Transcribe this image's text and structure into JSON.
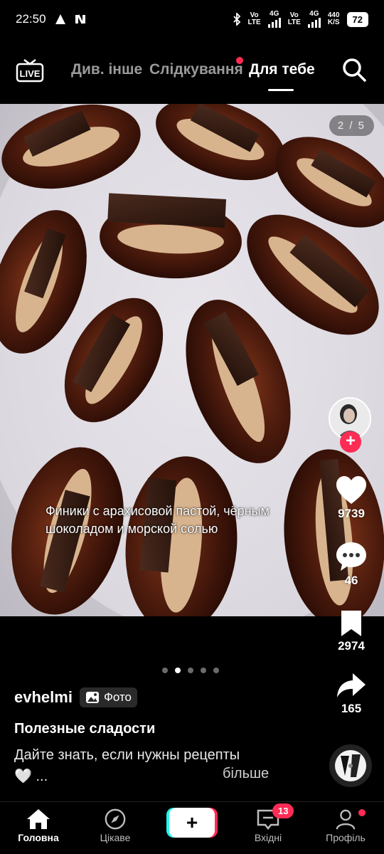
{
  "status": {
    "time": "22:50",
    "net1_top": "Vo",
    "net1_bottom": "LTE",
    "net2_top": "4G",
    "net3_top": "Vo",
    "net3_bottom": "LTE",
    "net4_top": "4G",
    "speed_top": "440",
    "speed_bottom": "K/S",
    "battery": "72"
  },
  "top_nav": {
    "tabs": [
      {
        "label": "Див. інше"
      },
      {
        "label": "Слідкування"
      },
      {
        "label": "Для тебе"
      }
    ],
    "live_label": "LIVE"
  },
  "post": {
    "counter": "2 / 5",
    "caption": "Финики с арахисовой пастой, чёрным шоколадом и морской солью",
    "author": "evhelmi",
    "badge": "Фото",
    "title": "Полезные сладости",
    "description": "Дайте знать, если нужны рецепты",
    "description_tail": "🤍 ...",
    "more": "більше",
    "active_slide": 1,
    "slide_count": 5
  },
  "actions": {
    "likes": "9739",
    "comments": "46",
    "saves": "2974",
    "shares": "165"
  },
  "bottom_nav": {
    "items": [
      {
        "label": "Головна"
      },
      {
        "label": "Цікаве"
      },
      {
        "label": "Вхідні"
      },
      {
        "label": "Профіль"
      }
    ],
    "inbox_badge": "13",
    "create_symbol": "+"
  },
  "colors": {
    "accent": "#fe2c55",
    "cyan": "#25f4ee"
  }
}
